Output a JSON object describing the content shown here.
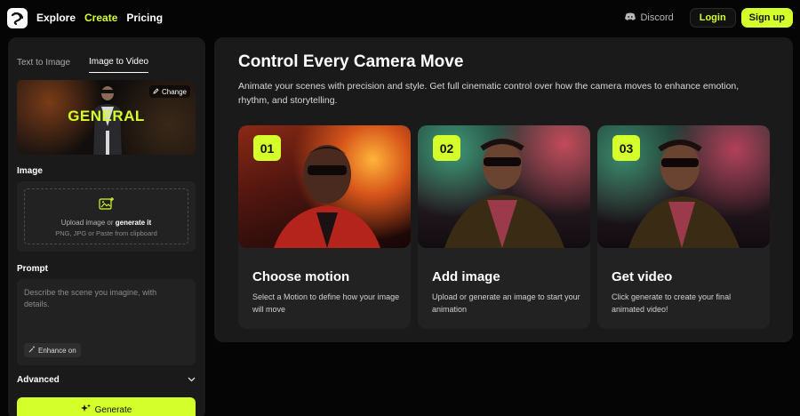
{
  "nav": {
    "links": [
      "Explore",
      "Create",
      "Pricing"
    ],
    "discord": "Discord",
    "login": "Login",
    "signup": "Sign up"
  },
  "sidebar": {
    "tabs": [
      "Text to Image",
      "Image to Video"
    ],
    "banner_title": "GENERAL",
    "change": "Change",
    "image_label": "Image",
    "upload_text_prefix": "Upload image or",
    "upload_text_link": "generate it",
    "upload_sub": "PNG, JPG or Paste from clipboard",
    "prompt_label": "Prompt",
    "prompt_placeholder": "Describe the scene you imagine, with details.",
    "enhance": "Enhance on",
    "advanced": "Advanced",
    "generate": "Generate"
  },
  "main": {
    "title": "Control Every Camera Move",
    "description": "Animate your scenes with precision and style. Get full cinematic control over how the camera moves to enhance emotion, rhythm, and storytelling.",
    "cards": [
      {
        "num": "01",
        "title": "Choose motion",
        "desc": "Select a Motion to define how your image will move"
      },
      {
        "num": "02",
        "title": "Add image",
        "desc": "Upload or generate an image to start your animation"
      },
      {
        "num": "03",
        "title": "Get video",
        "desc": "Click generate to create your final animated video!"
      }
    ]
  },
  "colors": {
    "accent": "#d4ff2a",
    "panel": "#1a1a1a",
    "background": "#050505"
  },
  "icons": [
    "logo-icon",
    "discord-icon",
    "pencil-icon",
    "image-add-icon",
    "wand-icon",
    "chevron-down-icon",
    "sparkle-icon"
  ]
}
